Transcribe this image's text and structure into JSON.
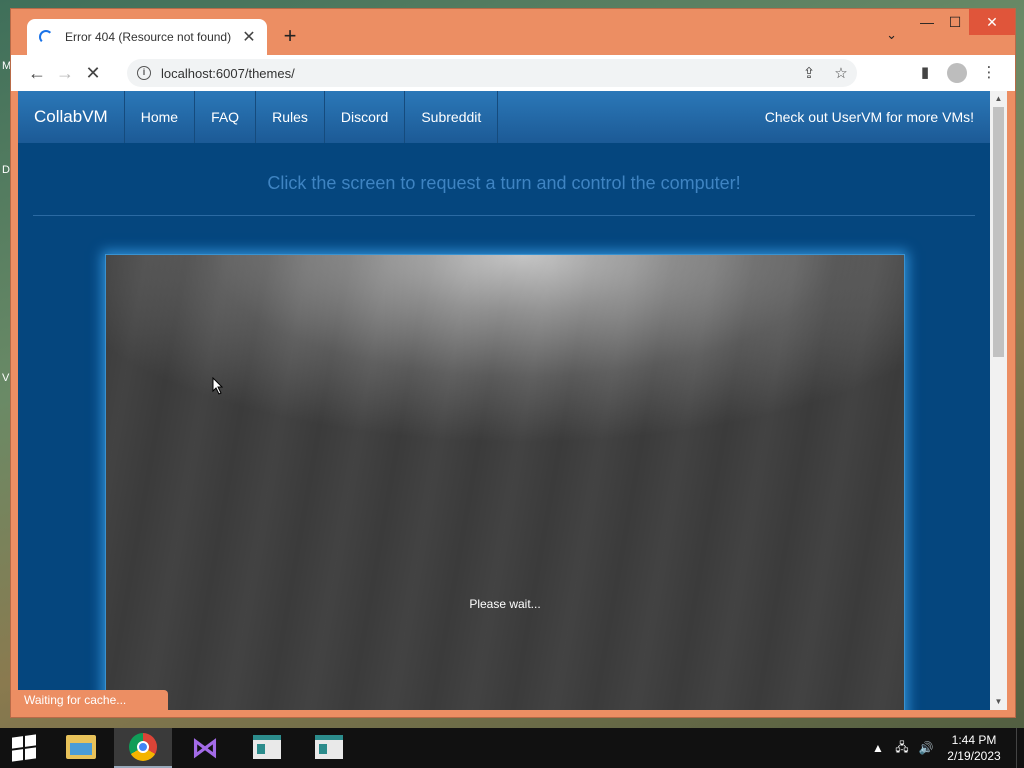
{
  "desktop": {
    "edge_letters": [
      "M",
      "D",
      "V"
    ]
  },
  "browser": {
    "tab_title": "Error 404 (Resource not found)",
    "tab_close": "✕",
    "new_tab": "+",
    "url": "localhost:6007/themes/",
    "status": "Waiting for cache...",
    "controls": {
      "minimize": "—",
      "maximize": "☐",
      "close": "✕"
    }
  },
  "page": {
    "brand": "CollabVM",
    "nav": [
      "Home",
      "FAQ",
      "Rules",
      "Discord",
      "Subreddit"
    ],
    "nav_right": "Check out UserVM for more VMs!",
    "turn_message": "Click the screen to request a turn and control the computer!",
    "vm_status": "Please wait..."
  },
  "taskbar": {
    "time": "1:44 PM",
    "date": "2/19/2023"
  },
  "colors": {
    "window_frame": "#ec8e63",
    "page_bg": "#05467e",
    "navbar": "#2b78b8",
    "vm_glow": "#2f8fd6"
  }
}
